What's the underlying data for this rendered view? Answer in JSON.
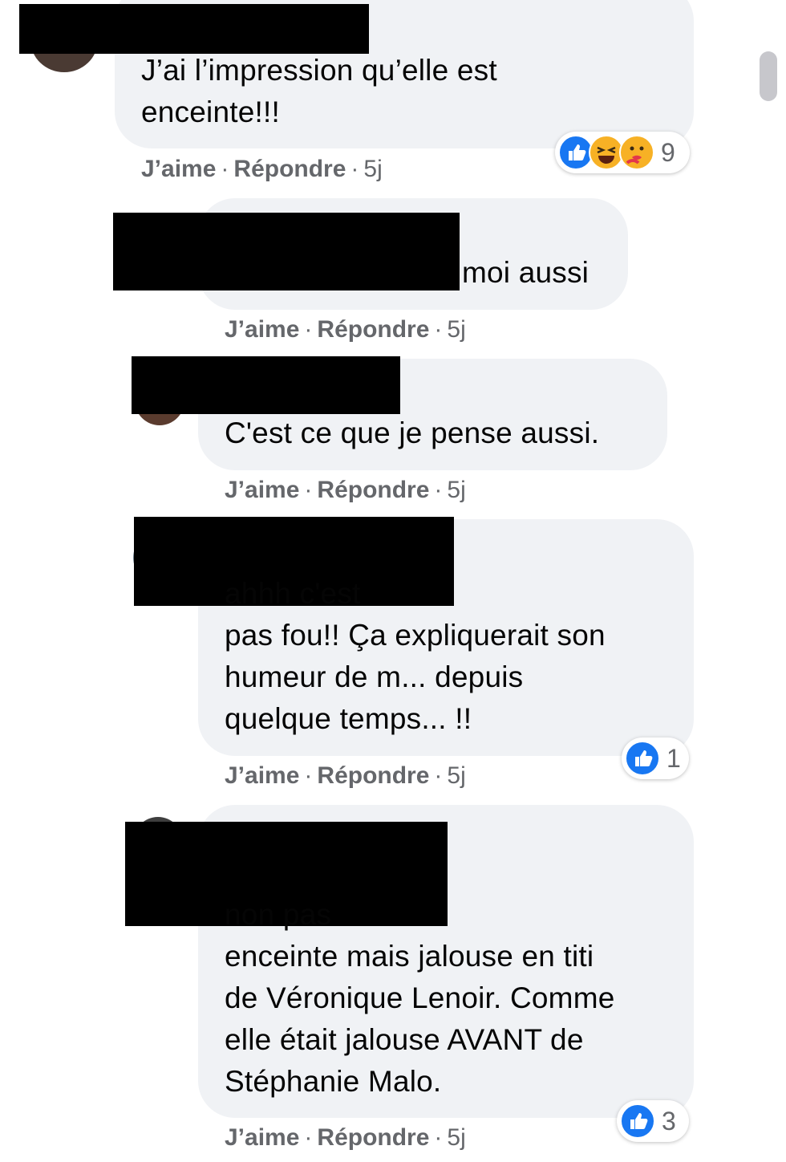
{
  "comments": [
    {
      "text": "J’ai l’impression qu’elle est\nenceinte!!!",
      "actions": {
        "like": "J’aime",
        "reply": "Répondre",
        "time": "5j",
        "sep": "·"
      },
      "reaction_count": "9",
      "reaction_icons": [
        "like-icon",
        "haha-icon",
        "care-icon"
      ]
    },
    {
      "text": "moi aussi",
      "actions": {
        "like": "J’aime",
        "reply": "Répondre",
        "time": "5j",
        "sep": "·"
      }
    },
    {
      "text": "C'est ce que je pense aussi.",
      "actions": {
        "like": "J’aime",
        "reply": "Répondre",
        "time": "5j",
        "sep": "·"
      }
    },
    {
      "text": "ahhh c'est\npas fou!! Ça expliquerait son\nhumeur de m... depuis\nquelque temps... !!",
      "actions": {
        "like": "J’aime",
        "reply": "Répondre",
        "time": "5j",
        "sep": "·"
      },
      "reaction_count": "1",
      "reaction_icons": [
        "like-icon"
      ]
    },
    {
      "text": "non pas\nenceinte mais jalouse en titi\nde Véronique Lenoir. Comme\nelle était jalouse AVANT de\nStéphanie Malo.",
      "actions": {
        "like": "J’aime",
        "reply": "Répondre",
        "time": "5j",
        "sep": "·"
      },
      "reaction_count": "3",
      "reaction_icons": [
        "like-icon"
      ]
    }
  ],
  "colors": {
    "bubble": "#f0f2f5",
    "meta_text": "#65676b",
    "like_blue": "#1877f2",
    "emoji_yellow": "#f7b125"
  }
}
